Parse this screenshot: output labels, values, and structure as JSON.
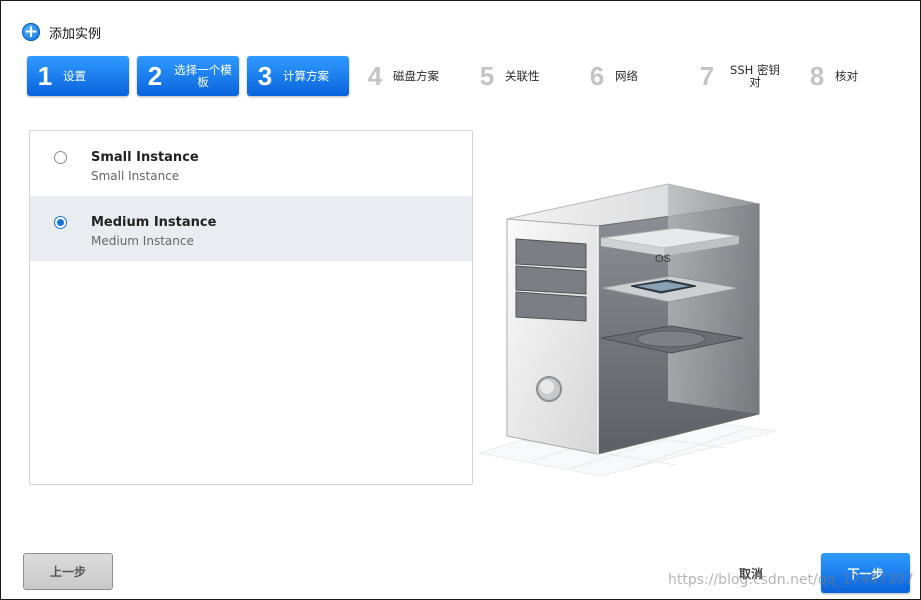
{
  "dialog": {
    "title": "添加实例"
  },
  "steps": [
    {
      "num": "1",
      "label": "设置",
      "active": true
    },
    {
      "num": "2",
      "label": "选择一个模板",
      "active": true
    },
    {
      "num": "3",
      "label": "计算方案",
      "active": true
    },
    {
      "num": "4",
      "label": "磁盘方案",
      "active": false
    },
    {
      "num": "5",
      "label": "关联性",
      "active": false
    },
    {
      "num": "6",
      "label": "网络",
      "active": false
    },
    {
      "num": "7",
      "label": "SSH 密钥对",
      "active": false
    },
    {
      "num": "8",
      "label": "核对",
      "active": false
    }
  ],
  "offerings": [
    {
      "name": "Small Instance",
      "desc": "Small Instance",
      "selected": false
    },
    {
      "name": "Medium Instance",
      "desc": "Medium Instance",
      "selected": true
    }
  ],
  "illustration": {
    "os_label": "OS"
  },
  "buttons": {
    "prev": "上一步",
    "cancel": "取消",
    "next": "下一步"
  },
  "watermark": "https://blog.csdn.net/qq_17447307",
  "colors": {
    "accent": "#0a73e8",
    "selected_row": "#e9edf2"
  }
}
